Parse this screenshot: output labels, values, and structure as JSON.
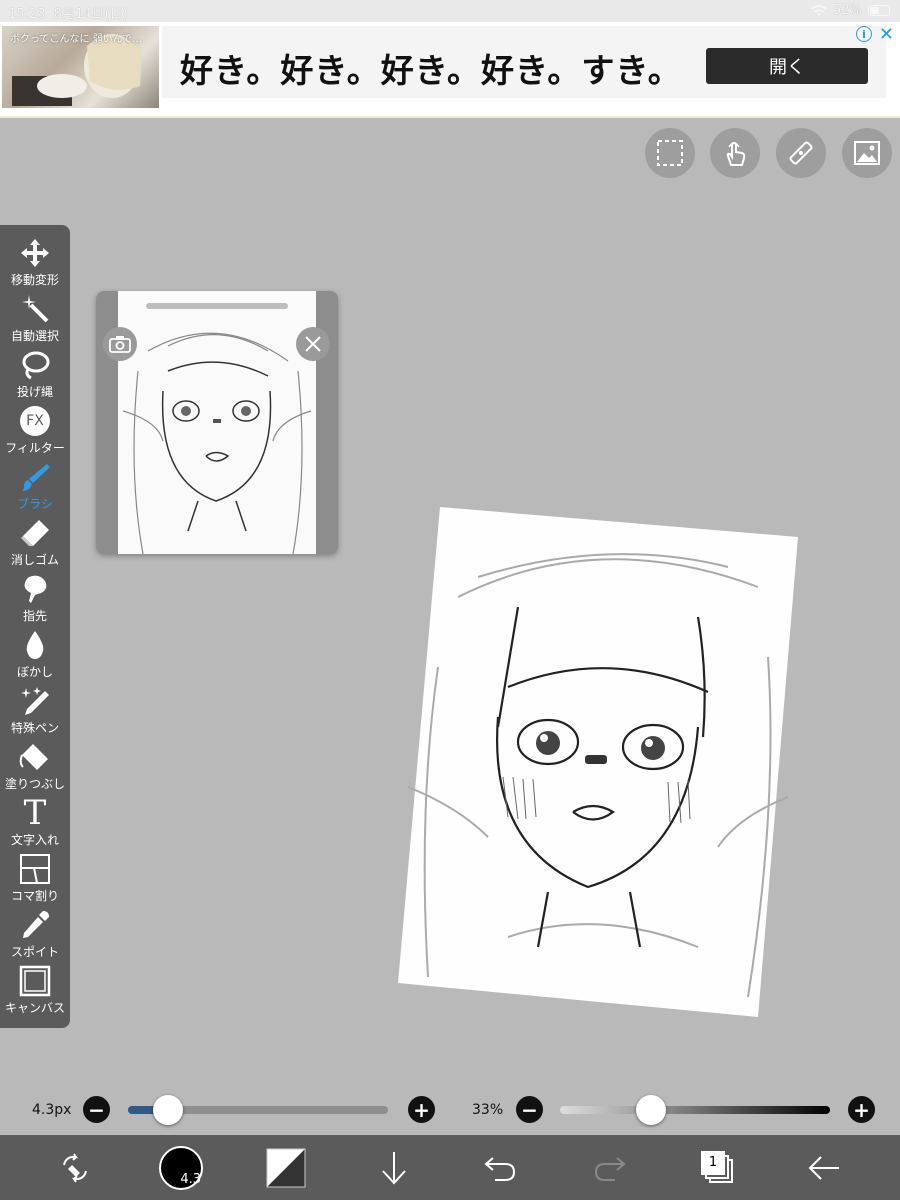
{
  "status_bar": {
    "time": "15:23",
    "date": "8月14日(日)",
    "battery": "52%"
  },
  "ad": {
    "thumbnail_caption": "ボクってこんなに 弱いんで…",
    "headline": "好き。好き。好き。好き。すき。",
    "open_label": "開く",
    "info_icon": "i",
    "close_icon": "✕"
  },
  "top_tools": [
    {
      "name": "selection-tool",
      "icon": "dashed-rect-icon"
    },
    {
      "name": "gesture-tool",
      "icon": "hand-tap-icon"
    },
    {
      "name": "ruler-tool",
      "icon": "ruler-icon"
    },
    {
      "name": "material-tool",
      "icon": "image-icon"
    }
  ],
  "toolbar": {
    "items": [
      {
        "label": "移動変形",
        "icon": "move-arrows-icon"
      },
      {
        "label": "自動選択",
        "icon": "magic-wand-icon"
      },
      {
        "label": "投げ縄",
        "icon": "lasso-icon"
      },
      {
        "label": "フィルター",
        "icon": "fx-icon",
        "glyph": "FX"
      },
      {
        "label": "ブラシ",
        "icon": "brush-icon"
      },
      {
        "label": "消しゴム",
        "icon": "eraser-icon"
      },
      {
        "label": "指先",
        "icon": "finger-icon"
      },
      {
        "label": "ぼかし",
        "icon": "blur-drop-icon"
      },
      {
        "label": "特殊ペン",
        "icon": "special-pen-icon"
      },
      {
        "label": "塗りつぶし",
        "icon": "bucket-icon"
      },
      {
        "label": "文字入れ",
        "icon": "text-icon",
        "glyph": "T"
      },
      {
        "label": "コマ割り",
        "icon": "frame-divider-icon"
      },
      {
        "label": "スポイト",
        "icon": "eyedropper-icon"
      },
      {
        "label": "キャンバス",
        "icon": "canvas-icon"
      }
    ],
    "active_index": 4,
    "active_color": "#2f9ae6"
  },
  "sliders": {
    "brush_size": {
      "label": "4.3px",
      "minus": "−",
      "plus": "+",
      "fraction": 0.12
    },
    "opacity": {
      "label": "33%",
      "minus": "−",
      "plus": "+",
      "fraction": 0.33
    }
  },
  "bottom_bar": {
    "color_value": "4.3",
    "layer_count": "1",
    "items": [
      "transform-swap-icon",
      "color-circle",
      "brush-preview",
      "download-icon",
      "undo-icon",
      "redo-icon",
      "layers-icon",
      "back-icon"
    ]
  }
}
